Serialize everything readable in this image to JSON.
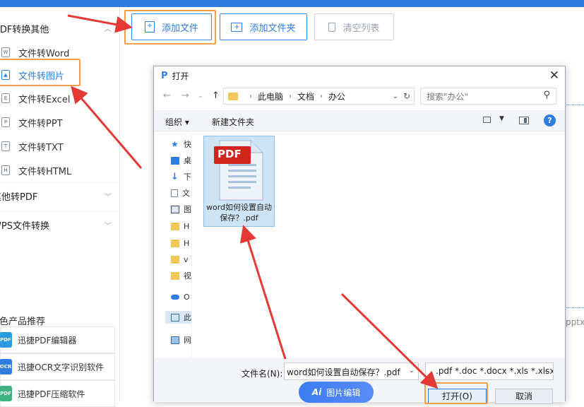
{
  "sidebar": {
    "header": "PDF转换其他",
    "items": [
      {
        "label": "文件转Word",
        "icon": "W"
      },
      {
        "label": "文件转图片",
        "icon": "image"
      },
      {
        "label": "文件转Excel",
        "icon": "E"
      },
      {
        "label": "文件转PPT",
        "icon": "P"
      },
      {
        "label": "文件转TXT",
        "icon": "T"
      },
      {
        "label": "文件转HTML",
        "icon": "H"
      }
    ],
    "sections": [
      {
        "label": "其他转PDF"
      },
      {
        "label": "WPS文件转换"
      }
    ],
    "promo_title": "特色产品推荐",
    "promos": [
      {
        "label": "迅捷PDF编辑器",
        "icon": "PDF",
        "color": "#2a9be0"
      },
      {
        "label": "迅捷OCR文字识别软件",
        "icon": "OCR",
        "color": "#2f7de1"
      },
      {
        "label": "迅捷PDF压缩软件",
        "icon": "PDF",
        "color": "#3fb37f"
      }
    ]
  },
  "toolbar": {
    "add_file": "添加文件",
    "add_folder": "添加文件夹",
    "clear_list": "清空列表"
  },
  "dialog": {
    "title": "打开",
    "path": [
      "此电脑",
      "文档",
      "办公"
    ],
    "search_placeholder": "搜索\"办公\"",
    "organize": "组织 ▾",
    "new_folder": "新建文件夹",
    "nav_items": [
      "快",
      "桌",
      "下",
      "文",
      "图",
      "H",
      "H",
      "v",
      "视",
      "O",
      "此",
      "网"
    ],
    "file": {
      "name": "word如何设置自动保存？.pdf",
      "badge": "PDF"
    },
    "filename_label": "文件名(N):",
    "filename_value": "word如何设置自动保存？.pdf",
    "file_types": ".pdf *.doc *.docx *.xls *.xlsx",
    "open_button": "打开(O)",
    "cancel_button": "取消"
  },
  "overlay": {
    "ai_badge": "Ai",
    "ai_label": "图片编辑",
    "right_text": "pptx"
  },
  "colors": {
    "accent": "#2f7de1",
    "highlight": "#f0a04b",
    "arrow": "#e53935"
  }
}
